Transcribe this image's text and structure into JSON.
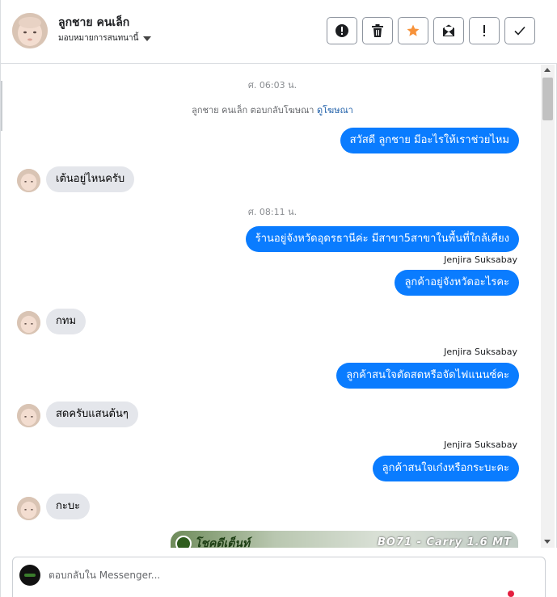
{
  "header": {
    "customer_name": "ลูกชาย คนเล็ก",
    "assign_label": "มอบหมายการสนทนานี้"
  },
  "toolbar": {
    "buttons": [
      {
        "name": "spam-button",
        "icon": "exclamation-circle-icon"
      },
      {
        "name": "delete-button",
        "icon": "trash-icon"
      },
      {
        "name": "star-button",
        "icon": "star-icon",
        "color": "#f7923a"
      },
      {
        "name": "mark-unread-button",
        "icon": "envelope-icon"
      },
      {
        "name": "follow-up-button",
        "icon": "exclamation-icon"
      },
      {
        "name": "done-button",
        "icon": "checkmark-icon"
      }
    ]
  },
  "conversation": {
    "timestamp_1": "ศ. 06:03 น.",
    "ad_reply_text": "ลูกชาย คนเล็ก ตอบกลับโฆษณา",
    "ad_reply_link": "ดูโฆษณา",
    "msg_out_1": "สวัสดี ลูกชาย มีอะไรให้เราช่วยไหม",
    "msg_in_1": "เต้นอยู่ไหนครับ",
    "timestamp_2": "ศ. 08:11 น.",
    "msg_out_2": "ร้านอยู่จังหวัดอุดรธานีค่ะ มีสาขา5สาขาในพื้นที่ใกล้เคียง",
    "sender_1": "Jenjira Suksabay",
    "msg_out_3": "ลูกค้าอยู่จังหวัดอะไรคะ",
    "msg_in_2": "กทม",
    "sender_2": "Jenjira Suksabay",
    "msg_out_4": "ลูกค้าสนใจตัดสดหรือจัดไฟแนนซ์คะ",
    "msg_in_3": "สดครับแสนต้นๆ",
    "sender_3": "Jenjira Suksabay",
    "msg_out_5": "ลูกค้าสนใจเก๋งหรือกระบะคะ",
    "msg_in_4": "กะบะ",
    "ad_image_logo": "โชคดีเต็นท์",
    "ad_image_text": "BO71 - Carry 1.6 MT"
  },
  "composer": {
    "placeholder": "ตอบกลับใน Messenger..."
  },
  "colors": {
    "outgoing_bubble": "#0a7cff",
    "incoming_bubble": "#e4e6eb",
    "link": "#1d5ea8",
    "notification_dot": "#e41e3f"
  }
}
